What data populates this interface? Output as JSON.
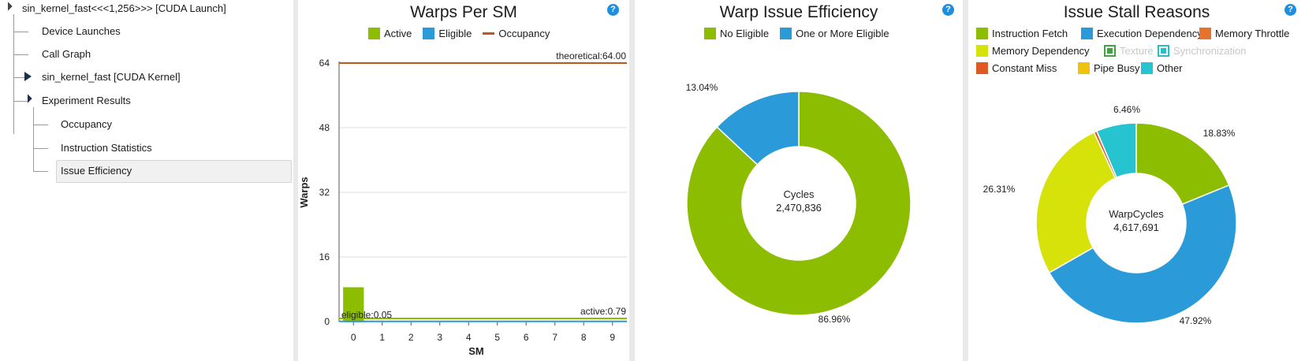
{
  "tree": {
    "items": [
      {
        "label": "sin_kernel_fast<<<1,256>>> [CUDA Launch]"
      },
      {
        "label": "Device Launches"
      },
      {
        "label": "Call Graph"
      },
      {
        "label": "sin_kernel_fast [CUDA Kernel]"
      },
      {
        "label": "Experiment Results"
      },
      {
        "label": "Occupancy"
      },
      {
        "label": "Instruction Statistics"
      },
      {
        "label": "Issue Efficiency"
      }
    ],
    "selected": "Issue Efficiency"
  },
  "help_label": "?",
  "warps_chart": {
    "title": "Warps Per SM",
    "legend": [
      {
        "label": "Active",
        "color": "#8cbd00",
        "kind": "box"
      },
      {
        "label": "Eligible",
        "color": "#2b9ad8",
        "kind": "box"
      },
      {
        "label": "Occupancy",
        "color": "#c0561b",
        "kind": "line"
      }
    ],
    "ylabel": "Warps",
    "xlabel": "SM",
    "annotations": {
      "theoretical": "theoretical:64.00",
      "active": "active:0.79",
      "eligible": "eligible:0.05"
    }
  },
  "efficiency_chart": {
    "title": "Warp Issue Efficiency",
    "center_label": "Cycles",
    "center_value": "2,470,836"
  },
  "stall_chart": {
    "title": "Issue Stall Reasons",
    "center_label": "WarpCycles",
    "center_value": "4,617,691",
    "legend_rows": [
      [
        {
          "label": "Instruction Fetch",
          "color": "#8cbd00",
          "dim": false,
          "kind": "box"
        },
        {
          "label": "Execution Dependency",
          "color": "#2b9ad8",
          "dim": false,
          "kind": "box"
        },
        {
          "label": "Memory Throttle",
          "color": "#e5732b",
          "dim": false,
          "kind": "box"
        }
      ],
      [
        {
          "label": "Memory Dependency",
          "color": "#d6e20a",
          "dim": false,
          "kind": "box"
        },
        {
          "label": "Texture",
          "color": "#3da53d",
          "dim": true,
          "kind": "hollow"
        },
        {
          "label": "Synchronization",
          "color": "#26c0cc",
          "dim": true,
          "kind": "hollow"
        }
      ],
      [
        {
          "label": "Constant Miss",
          "color": "#dd5a22",
          "dim": false,
          "kind": "box"
        },
        {
          "label": "Pipe Busy",
          "color": "#f0c20c",
          "dim": false,
          "kind": "box"
        },
        {
          "label": "Other",
          "color": "#26c4d0",
          "dim": false,
          "kind": "box"
        }
      ]
    ]
  },
  "chart_data": [
    {
      "type": "bar",
      "title": "Warps Per SM",
      "xlabel": "SM",
      "ylabel": "Warps",
      "categories": [
        "0",
        "1",
        "2",
        "3",
        "4",
        "5",
        "6",
        "7",
        "8",
        "9"
      ],
      "series": [
        {
          "name": "Active",
          "color": "#8cbd00",
          "values": [
            8.5,
            0,
            0,
            0,
            0,
            0,
            0,
            0,
            0,
            0
          ]
        },
        {
          "name": "Eligible",
          "color": "#2b9ad8",
          "values": [
            0.05,
            0,
            0,
            0,
            0,
            0,
            0,
            0,
            0,
            0
          ]
        }
      ],
      "lines": [
        {
          "name": "Occupancy",
          "label": "theoretical:64.00",
          "value": 64,
          "color": "#c0561b"
        },
        {
          "label": "active:0.79",
          "value": 0.79,
          "color": "#8cbd00"
        },
        {
          "label": "eligible:0.05",
          "value": 0.05,
          "color": "#2b9ad8"
        }
      ],
      "yticks": [
        0,
        16,
        32,
        48,
        64
      ],
      "ylim": [
        0,
        64
      ],
      "grid": true
    },
    {
      "type": "pie",
      "title": "Warp Issue Efficiency",
      "legend": [
        "No Eligible",
        "One or More Eligible"
      ],
      "slices": [
        {
          "name": "No Eligible",
          "value": 86.96,
          "label": "86.96%",
          "color": "#8cbd00"
        },
        {
          "name": "One or More Eligible",
          "value": 13.04,
          "label": "13.04%",
          "color": "#2b9ad8"
        }
      ]
    },
    {
      "type": "pie",
      "title": "Issue Stall Reasons",
      "slices": [
        {
          "name": "Instruction Fetch",
          "value": 18.83,
          "label": "18.83%",
          "color": "#8cbd00"
        },
        {
          "name": "Execution Dependency",
          "value": 47.92,
          "label": "47.92%",
          "color": "#2b9ad8"
        },
        {
          "name": "Memory Dependency",
          "value": 26.31,
          "label": "26.31%",
          "color": "#d6e20a"
        },
        {
          "name": "Constant Miss",
          "value": 0.48,
          "label": "",
          "color": "#dd5a22"
        },
        {
          "name": "Other",
          "value": 6.46,
          "label": "6.46%",
          "color": "#26c4d0"
        }
      ]
    }
  ]
}
